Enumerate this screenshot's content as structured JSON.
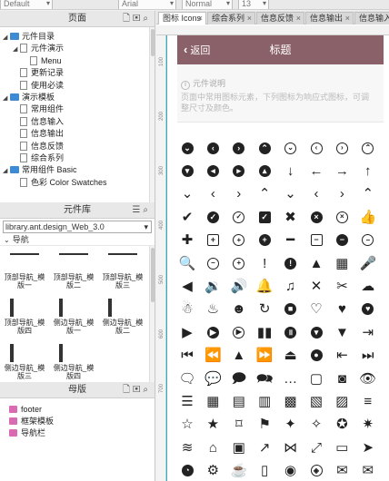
{
  "toolbar": {
    "style_select": "Default",
    "font_select": "Arial",
    "weight_select": "Normal",
    "size_select": "13"
  },
  "pages_panel": {
    "title": "页面",
    "items": [
      {
        "label": "元件目录",
        "type": "folder",
        "level": 0,
        "expanded": true
      },
      {
        "label": "元件演示",
        "type": "page",
        "level": 1,
        "expanded": true
      },
      {
        "label": "Menu",
        "type": "page",
        "level": 2
      },
      {
        "label": "更新记录",
        "type": "page",
        "level": 1
      },
      {
        "label": "使用必读",
        "type": "page",
        "level": 1
      },
      {
        "label": "演示模板",
        "type": "folder",
        "level": 0,
        "expanded": true
      },
      {
        "label": "常用组件",
        "type": "page",
        "level": 1
      },
      {
        "label": "信息输入",
        "type": "page",
        "level": 1
      },
      {
        "label": "信息输出",
        "type": "page",
        "level": 1
      },
      {
        "label": "信息反馈",
        "type": "page",
        "level": 1
      },
      {
        "label": "综合系列",
        "type": "page",
        "level": 1
      },
      {
        "label": "常用组件 Basic",
        "type": "folder",
        "level": 0,
        "expanded": true
      },
      {
        "label": "色彩 Color Swatches",
        "type": "page",
        "level": 1
      }
    ]
  },
  "library_panel": {
    "title": "元件库",
    "library": "library.ant.design_Web_3.0",
    "section": "导航",
    "widgets": [
      {
        "label": "顶部导航_模版一",
        "kind": "top"
      },
      {
        "label": "顶部导航_模版二",
        "kind": "top"
      },
      {
        "label": "顶部导航_模版三",
        "kind": "top"
      },
      {
        "label": "顶部导航_模版四",
        "kind": "side"
      },
      {
        "label": "侧边导航_模版一",
        "kind": "side"
      },
      {
        "label": "侧边导航_模版二",
        "kind": "side"
      },
      {
        "label": "侧边导航_模版三",
        "kind": "side"
      },
      {
        "label": "侧边导航_模版四",
        "kind": "side"
      }
    ]
  },
  "masters_panel": {
    "title": "母版",
    "items": [
      "footer",
      "框架模板",
      "导航栏"
    ]
  },
  "tabs": [
    {
      "label": "图标 Icons",
      "active": true
    },
    {
      "label": "综合系列",
      "active": false
    },
    {
      "label": "信息反馈",
      "active": false
    },
    {
      "label": "信息输出",
      "active": false
    },
    {
      "label": "信息输入",
      "active": false
    }
  ],
  "ruler": {
    "left_marks": [
      "100",
      "200",
      "300",
      "400",
      "500",
      "600",
      "700"
    ]
  },
  "canvas": {
    "nav_bar_color": "#8b6169",
    "back_label": "返回",
    "nav_title": "标题",
    "desc_title": "元件说明",
    "desc_text": "页面中常用图标元素，下列图标为响应式图标，可调整尺寸及颜色。",
    "icons": [
      "circle-down-icon",
      "circle-left-icon",
      "circle-right-icon",
      "circle-up-icon",
      "circle-down-outline-icon",
      "circle-left-outline-icon",
      "circle-right-outline-icon",
      "circle-up-outline-icon",
      "circle-chevron-down-icon",
      "circle-chevron-left-icon",
      "circle-chevron-right-icon",
      "circle-chevron-up-icon",
      "arrow-down-icon",
      "arrow-left-icon",
      "arrow-right-icon",
      "arrow-up-icon",
      "chevron-down-icon",
      "chevron-left-icon",
      "chevron-right-icon",
      "chevron-up-icon",
      "chevron-down-small-icon",
      "chevron-left-small-icon",
      "chevron-right-small-icon",
      "chevron-up-small-icon",
      "check-icon",
      "check-circle-icon",
      "check-circle-outline-icon",
      "check-square-icon",
      "close-icon",
      "close-circle-icon",
      "close-circle-outline-icon",
      "thumbs-up-icon",
      "plus-icon",
      "plus-square-outline-icon",
      "plus-circle-outline-icon",
      "plus-circle-icon",
      "minus-icon",
      "minus-square-outline-icon",
      "minus-circle-icon",
      "minus-circle-outline-icon",
      "search-icon",
      "zoom-out-icon",
      "zoom-in-icon",
      "exclamation-icon",
      "exclamation-circle-icon",
      "warning-icon",
      "calendar-icon",
      "microphone-icon",
      "volume-mute-icon",
      "volume-low-icon",
      "volume-high-icon",
      "bell-icon",
      "bell-outline-icon",
      "bell-off-icon",
      "bell-slash-icon",
      "cloud-icon",
      "qq-icon",
      "weibo-icon",
      "wechat-icon",
      "refresh-icon",
      "stop-circle-icon",
      "heart-outline-icon",
      "heart-icon",
      "heart-circle-icon",
      "play-icon",
      "play-circle-icon",
      "play-circle-outline-icon",
      "pause-icon",
      "pause-circle-icon",
      "caret-down-circle-icon",
      "caret-down-icon",
      "exit-icon",
      "fast-backward-icon",
      "step-backward-icon",
      "caret-up-icon",
      "step-forward-icon",
      "eject-icon",
      "record-icon",
      "logout-icon",
      "step-forward-bar-icon",
      "comment-icon",
      "comment-outline-icon",
      "comments-icon",
      "chat-icon",
      "comment-dots-icon",
      "comment-empty-icon",
      "chat-bubble-icon",
      "eye-icon",
      "list-icon",
      "grid-icon",
      "th-icon",
      "list-alt-icon",
      "th-large-icon",
      "tasks-icon",
      "table-icon",
      "bars-icon",
      "star-outline-icon",
      "star-icon",
      "bookmark-outline-icon",
      "bookmark-icon",
      "puzzle-icon",
      "puzzle-outline-icon",
      "puzzle-piece-icon",
      "puzzle-solid-icon",
      "wifi-icon",
      "home-icon",
      "image-icon",
      "share-icon",
      "share-nodes-icon",
      "expand-icon",
      "monitor-icon",
      "send-icon",
      "dashboard-icon",
      "settings-icon",
      "coffee-icon",
      "trash-icon",
      "camera-icon",
      "compass-icon",
      "mail-icon",
      "mail-open-icon"
    ]
  }
}
